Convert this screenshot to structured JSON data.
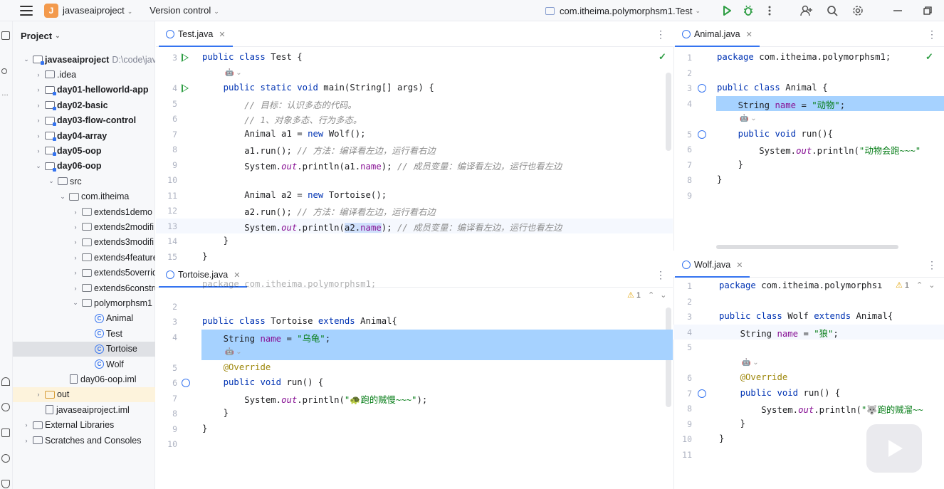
{
  "titlebar": {
    "project_badge": "J",
    "project_name": "javaseaiproject",
    "version_control": "Version control",
    "run_config": "com.itheima.polymorphsm1.Test"
  },
  "project_panel": {
    "title": "Project",
    "tree": [
      {
        "label": "javaseaiproject",
        "path": "D:\\code\\jav",
        "depth": 0,
        "expanded": true,
        "kind": "module"
      },
      {
        "label": ".idea",
        "depth": 1,
        "expanded": false,
        "kind": "folder"
      },
      {
        "label": "day01-helloworld-app",
        "depth": 1,
        "expanded": false,
        "kind": "module"
      },
      {
        "label": "day02-basic",
        "depth": 1,
        "expanded": false,
        "kind": "module"
      },
      {
        "label": "day03-flow-control",
        "depth": 1,
        "expanded": false,
        "kind": "module"
      },
      {
        "label": "day04-array",
        "depth": 1,
        "expanded": false,
        "kind": "module"
      },
      {
        "label": "day05-oop",
        "depth": 1,
        "expanded": false,
        "kind": "module"
      },
      {
        "label": "day06-oop",
        "depth": 1,
        "expanded": true,
        "kind": "module"
      },
      {
        "label": "src",
        "depth": 2,
        "expanded": true,
        "kind": "folder"
      },
      {
        "label": "com.itheima",
        "depth": 3,
        "expanded": true,
        "kind": "package"
      },
      {
        "label": "extends1demo",
        "depth": 4,
        "expanded": false,
        "kind": "package"
      },
      {
        "label": "extends2modifi",
        "depth": 4,
        "expanded": false,
        "kind": "package"
      },
      {
        "label": "extends3modifi",
        "depth": 4,
        "expanded": false,
        "kind": "package"
      },
      {
        "label": "extends4feature",
        "depth": 4,
        "expanded": false,
        "kind": "package"
      },
      {
        "label": "extends5overrid",
        "depth": 4,
        "expanded": false,
        "kind": "package"
      },
      {
        "label": "extends6constru",
        "depth": 4,
        "expanded": false,
        "kind": "package"
      },
      {
        "label": "polymorphsm1",
        "depth": 4,
        "expanded": true,
        "kind": "package"
      },
      {
        "label": "Animal",
        "depth": 5,
        "kind": "class"
      },
      {
        "label": "Test",
        "depth": 5,
        "kind": "class"
      },
      {
        "label": "Tortoise",
        "depth": 5,
        "kind": "class",
        "selected": true
      },
      {
        "label": "Wolf",
        "depth": 5,
        "kind": "class"
      },
      {
        "label": "day06-oop.iml",
        "depth": 3,
        "kind": "file"
      },
      {
        "label": "out",
        "depth": 1,
        "expanded": false,
        "kind": "out-folder",
        "highlight": true
      },
      {
        "label": "javaseaiproject.iml",
        "depth": 1,
        "kind": "file"
      },
      {
        "label": "External Libraries",
        "depth": 0,
        "expanded": false,
        "kind": "lib"
      },
      {
        "label": "Scratches and Consoles",
        "depth": 0,
        "expanded": false,
        "kind": "scratch"
      }
    ]
  },
  "editors": {
    "test": {
      "tab": "Test.java",
      "status": "✓",
      "lines": [
        {
          "n": "3",
          "html": [
            [
              "kw",
              "public class "
            ],
            [
              "",
              "Test {"
            ]
          ],
          "run": true
        },
        {
          "n": "",
          "hint": "🤖 ⌄"
        },
        {
          "n": "4",
          "html": [
            [
              "",
              "    "
            ],
            [
              "kw",
              "public static void "
            ],
            [
              "",
              "main(String[] args) {"
            ]
          ],
          "run": true
        },
        {
          "n": "5",
          "html": [
            [
              "",
              "        "
            ],
            [
              "cm",
              "// 目标：认识多态的代码。"
            ]
          ]
        },
        {
          "n": "6",
          "html": [
            [
              "",
              "        "
            ],
            [
              "cm",
              "// 1、对象多态、行为多态。"
            ]
          ]
        },
        {
          "n": "7",
          "html": [
            [
              "",
              "        Animal a1 = "
            ],
            [
              "kw",
              "new "
            ],
            [
              "",
              "Wolf();"
            ]
          ]
        },
        {
          "n": "8",
          "html": [
            [
              "",
              "        a1.run(); "
            ],
            [
              "cm",
              "// 方法：编译看左边，运行看右边"
            ]
          ]
        },
        {
          "n": "9",
          "html": [
            [
              "",
              "        System."
            ],
            [
              "st",
              "out"
            ],
            [
              "",
              ".println(a1."
            ],
            [
              "fld",
              "name"
            ],
            [
              "",
              "); "
            ],
            [
              "cm",
              "// 成员变量：编译看左边，运行也看左边"
            ]
          ]
        },
        {
          "n": "10",
          "html": []
        },
        {
          "n": "11",
          "html": [
            [
              "",
              "        Animal a2 = "
            ],
            [
              "kw",
              "new "
            ],
            [
              "",
              "Tortoise();"
            ]
          ]
        },
        {
          "n": "12",
          "html": [
            [
              "",
              "        a2.run(); "
            ],
            [
              "cm",
              "// 方法：编译看左边，运行看右边"
            ]
          ]
        },
        {
          "n": "13",
          "html": [
            [
              "",
              "        System."
            ],
            [
              "st",
              "out"
            ],
            [
              "",
              ".println("
            ],
            [
              "hl",
              "a2."
            ],
            [
              "hlf",
              "name"
            ],
            [
              "",
              "); "
            ],
            [
              "cm",
              "// 成员变量：编译看左边，运行也看左边"
            ]
          ],
          "current": true
        },
        {
          "n": "14",
          "html": [
            [
              "",
              "    }"
            ]
          ]
        },
        {
          "n": "15",
          "html": [
            [
              "",
              "}"
            ]
          ]
        }
      ]
    },
    "tortoise": {
      "tab": "Tortoise.java",
      "warning": "1",
      "lines": [
        {
          "n": "",
          "html": [
            [
              "",
              "package com.itheima.polymorphsm1;"
            ]
          ],
          "faded": true
        },
        {
          "n": "2",
          "html": []
        },
        {
          "n": "3",
          "html": [
            [
              "kw",
              "public class "
            ],
            [
              "",
              "Tortoise "
            ],
            [
              "kw",
              "extends "
            ],
            [
              "",
              "Animal{"
            ]
          ]
        },
        {
          "n": "4",
          "html": [
            [
              "",
              "    String "
            ],
            [
              "fld",
              "name"
            ],
            [
              "",
              " = "
            ],
            [
              "str",
              "\"乌龟\""
            ],
            [
              "",
              ";"
            ]
          ],
          "selected": true
        },
        {
          "n": "",
          "hint": "🤖 ⌄",
          "selected": true
        },
        {
          "n": "5",
          "html": [
            [
              "",
              "    "
            ],
            [
              "ann",
              "@Override"
            ]
          ]
        },
        {
          "n": "6",
          "html": [
            [
              "",
              "    "
            ],
            [
              "kw",
              "public void "
            ],
            [
              "",
              "run() {"
            ]
          ],
          "override": true
        },
        {
          "n": "7",
          "html": [
            [
              "",
              "        System."
            ],
            [
              "st",
              "out"
            ],
            [
              "",
              ".println("
            ],
            [
              "str",
              "\"🐢跑的贼慢~~~\""
            ],
            [
              "",
              ");"
            ]
          ]
        },
        {
          "n": "8",
          "html": [
            [
              "",
              "    }"
            ]
          ]
        },
        {
          "n": "9",
          "html": [
            [
              "",
              "}"
            ]
          ]
        },
        {
          "n": "10",
          "html": []
        }
      ]
    },
    "animal": {
      "tab": "Animal.java",
      "status": "✓",
      "lines": [
        {
          "n": "1",
          "html": [
            [
              "kw",
              "package "
            ],
            [
              "",
              "com.itheima.polymorphsm1;"
            ]
          ]
        },
        {
          "n": "2",
          "html": []
        },
        {
          "n": "3",
          "html": [
            [
              "kw",
              "public class "
            ],
            [
              "",
              "Animal {"
            ]
          ],
          "override": true
        },
        {
          "n": "4",
          "html": [
            [
              "",
              "    String "
            ],
            [
              "fld",
              "name"
            ],
            [
              "",
              " = "
            ],
            [
              "str",
              "\"动物\""
            ],
            [
              "",
              ";"
            ]
          ],
          "selected": true
        },
        {
          "n": "",
          "hint": "🤖 ⌄"
        },
        {
          "n": "5",
          "html": [
            [
              "",
              "    "
            ],
            [
              "kw",
              "public void "
            ],
            [
              "",
              "run(){"
            ]
          ],
          "override": true
        },
        {
          "n": "6",
          "html": [
            [
              "",
              "        System."
            ],
            [
              "st",
              "out"
            ],
            [
              "",
              ".println("
            ],
            [
              "str",
              "\"动物会跑~~~\""
            ],
            [
              ")"
            ]
          ]
        },
        {
          "n": "7",
          "html": [
            [
              "",
              "    }"
            ]
          ]
        },
        {
          "n": "8",
          "html": [
            [
              "",
              "}"
            ]
          ]
        },
        {
          "n": "9",
          "html": []
        }
      ]
    },
    "wolf": {
      "tab": "Wolf.java",
      "warning": "1",
      "lines": [
        {
          "n": "1",
          "html": [
            [
              "kw",
              "package "
            ],
            [
              "",
              "com.itheima.polymorphsı"
            ]
          ]
        },
        {
          "n": "2",
          "html": []
        },
        {
          "n": "3",
          "html": [
            [
              "kw",
              "public class "
            ],
            [
              "",
              "Wolf "
            ],
            [
              "kw",
              "extends "
            ],
            [
              "",
              "Animal{"
            ]
          ]
        },
        {
          "n": "4",
          "html": [
            [
              "",
              "    String "
            ],
            [
              "fld",
              "name"
            ],
            [
              "",
              " = "
            ],
            [
              "str",
              "\"狼\""
            ],
            [
              "",
              ";"
            ]
          ],
          "current": true
        },
        {
          "n": "5",
          "html": []
        },
        {
          "n": "",
          "hint": "🤖 ⌄"
        },
        {
          "n": "6",
          "html": [
            [
              "",
              "    "
            ],
            [
              "ann",
              "@Override"
            ]
          ]
        },
        {
          "n": "7",
          "html": [
            [
              "",
              "    "
            ],
            [
              "kw",
              "public void "
            ],
            [
              "",
              "run() {"
            ]
          ],
          "override": true
        },
        {
          "n": "8",
          "html": [
            [
              "",
              "        System."
            ],
            [
              "st",
              "out"
            ],
            [
              "",
              ".println("
            ],
            [
              "str",
              "\"🐺跑的贼溜~~"
            ]
          ]
        },
        {
          "n": "9",
          "html": [
            [
              "",
              "    }"
            ]
          ]
        },
        {
          "n": "10",
          "html": [
            [
              "",
              "}"
            ]
          ]
        },
        {
          "n": "11",
          "html": []
        }
      ]
    }
  },
  "colors": {
    "keyword": "#0033b3",
    "field": "#871094",
    "string": "#067d17",
    "comment": "#8c8c8c",
    "annotation": "#9e880d",
    "selection": "#a6d2ff",
    "accent": "#3574f0",
    "run": "#2f9e44"
  },
  "icons": {
    "main_menu": "hamburger-icon",
    "run": "play-icon",
    "debug": "bug-icon",
    "more": "kebab-icon",
    "add_user": "add-user-icon",
    "search": "search-icon",
    "settings": "gear-icon",
    "minimize": "minimize-icon",
    "restore": "restore-icon"
  }
}
